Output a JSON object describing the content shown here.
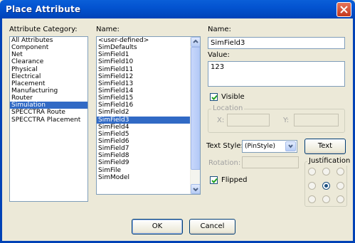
{
  "window": {
    "title": "Place Attribute"
  },
  "category": {
    "label": "Attribute Category:",
    "items": [
      "All Attributes",
      "Component",
      "Net",
      "Clearance",
      "Physical",
      "Electrical",
      "Placement",
      "Manufacturing",
      "Router",
      "Simulation",
      "SPECCTRA Route",
      "SPECCTRA Placement"
    ],
    "selected_index": 9
  },
  "names": {
    "label": "Name:",
    "items": [
      "<user-defined>",
      "SimDefaults",
      "SimField1",
      "SimField10",
      "SimField11",
      "SimField12",
      "SimField13",
      "SimField14",
      "SimField15",
      "SimField16",
      "SimField2",
      "SimField3",
      "SimField4",
      "SimField5",
      "SimField6",
      "SimField7",
      "SimField8",
      "SimField9",
      "SimFile",
      "SimModel"
    ],
    "selected_index": 11
  },
  "detail": {
    "name_label": "Name:",
    "name_value": "SimField3",
    "value_label": "Value:",
    "value_value": "123",
    "visible_label": "Visible",
    "visible_checked": true,
    "location_label": "Location",
    "x_label": "X:",
    "y_label": "Y:",
    "text_style_label": "Text Style:",
    "text_style_value": "(PinStyle)",
    "text_styles_button": "Text Styles...",
    "rotation_label": "Rotation:",
    "flipped_label": "Flipped",
    "flipped_checked": true,
    "justification_label": "Justification",
    "justification_selected": 4
  },
  "buttons": {
    "ok": "OK",
    "cancel": "Cancel"
  }
}
